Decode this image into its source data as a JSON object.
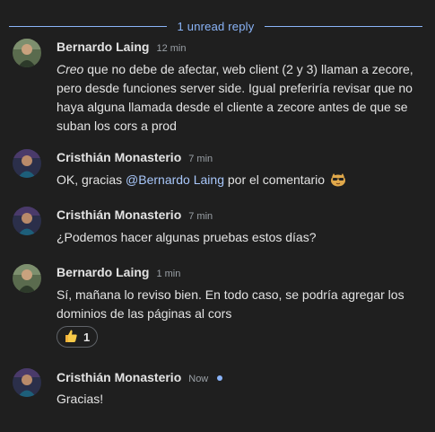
{
  "divider": {
    "label": "1 unread reply"
  },
  "messages": [
    {
      "author": "Bernardo Laing",
      "time": "12 min",
      "text_italic": "Creo",
      "text_rest": " que no debe de afectar, web client (2 y 3) llaman a zecore, pero desde funciones server side. Igual preferiría revisar que no haya alguna llamada desde el cliente a zecore antes de que se suban los cors a prod"
    },
    {
      "author": "Cristhián Monasterio",
      "time": "7 min",
      "text_before": "OK, gracias ",
      "mention": "@Bernardo Laing",
      "text_after": " por el comentario ",
      "emoji": "cool-cat-sunglasses-emoji"
    },
    {
      "author": "Cristhián Monasterio",
      "time": "7 min",
      "text": "¿Podemos hacer algunas pruebas estos días?"
    },
    {
      "author": "Bernardo Laing",
      "time": "1 min",
      "text": "Sí, mañana lo reviso bien. En todo caso, se podría agregar los dominios de las páginas al cors",
      "reaction": {
        "emoji": "thumbs-up-icon",
        "count": "1"
      }
    },
    {
      "author": "Cristhián Monasterio",
      "time": "Now",
      "text": "Gracias!",
      "unread": true
    }
  ],
  "colors": {
    "background": "#1f1f1f",
    "accent": "#8ab4f8",
    "mention": "#a8c7fa",
    "text": "#e3e3e3",
    "muted": "#9aa0a6"
  }
}
